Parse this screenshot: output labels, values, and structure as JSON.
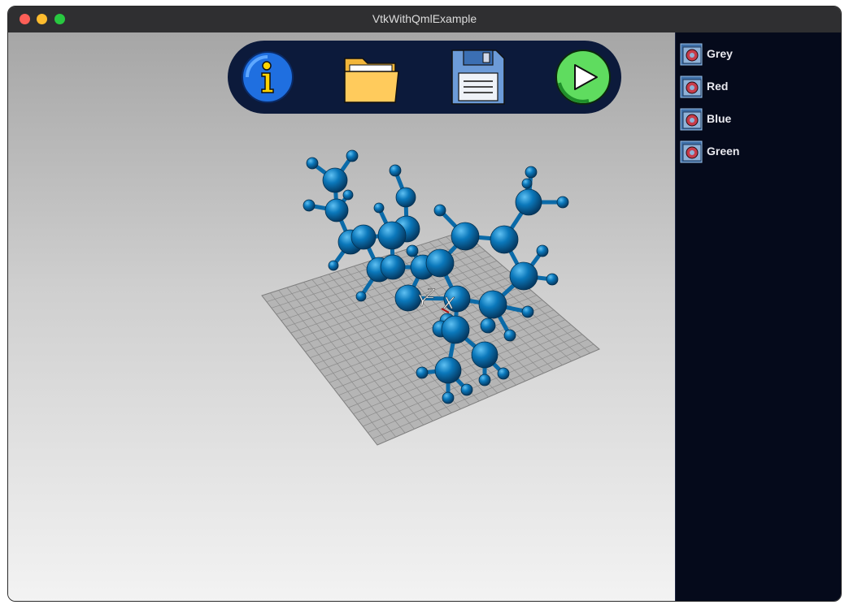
{
  "window": {
    "title": "VtkWithQmlExample"
  },
  "toolbar": {
    "buttons": [
      {
        "name": "info",
        "icon": "info-icon"
      },
      {
        "name": "open",
        "icon": "folder-icon"
      },
      {
        "name": "save",
        "icon": "floppy-disk-icon"
      },
      {
        "name": "play",
        "icon": "play-icon"
      }
    ]
  },
  "scene": {
    "axes": {
      "x": "X",
      "y": "Y",
      "z": "Z"
    },
    "molecule_color": "#0a74b8",
    "grid_color": "#bdbdbd"
  },
  "filters": {
    "items": [
      {
        "label": "Grey"
      },
      {
        "label": "Red"
      },
      {
        "label": "Blue"
      },
      {
        "label": "Green"
      }
    ]
  }
}
